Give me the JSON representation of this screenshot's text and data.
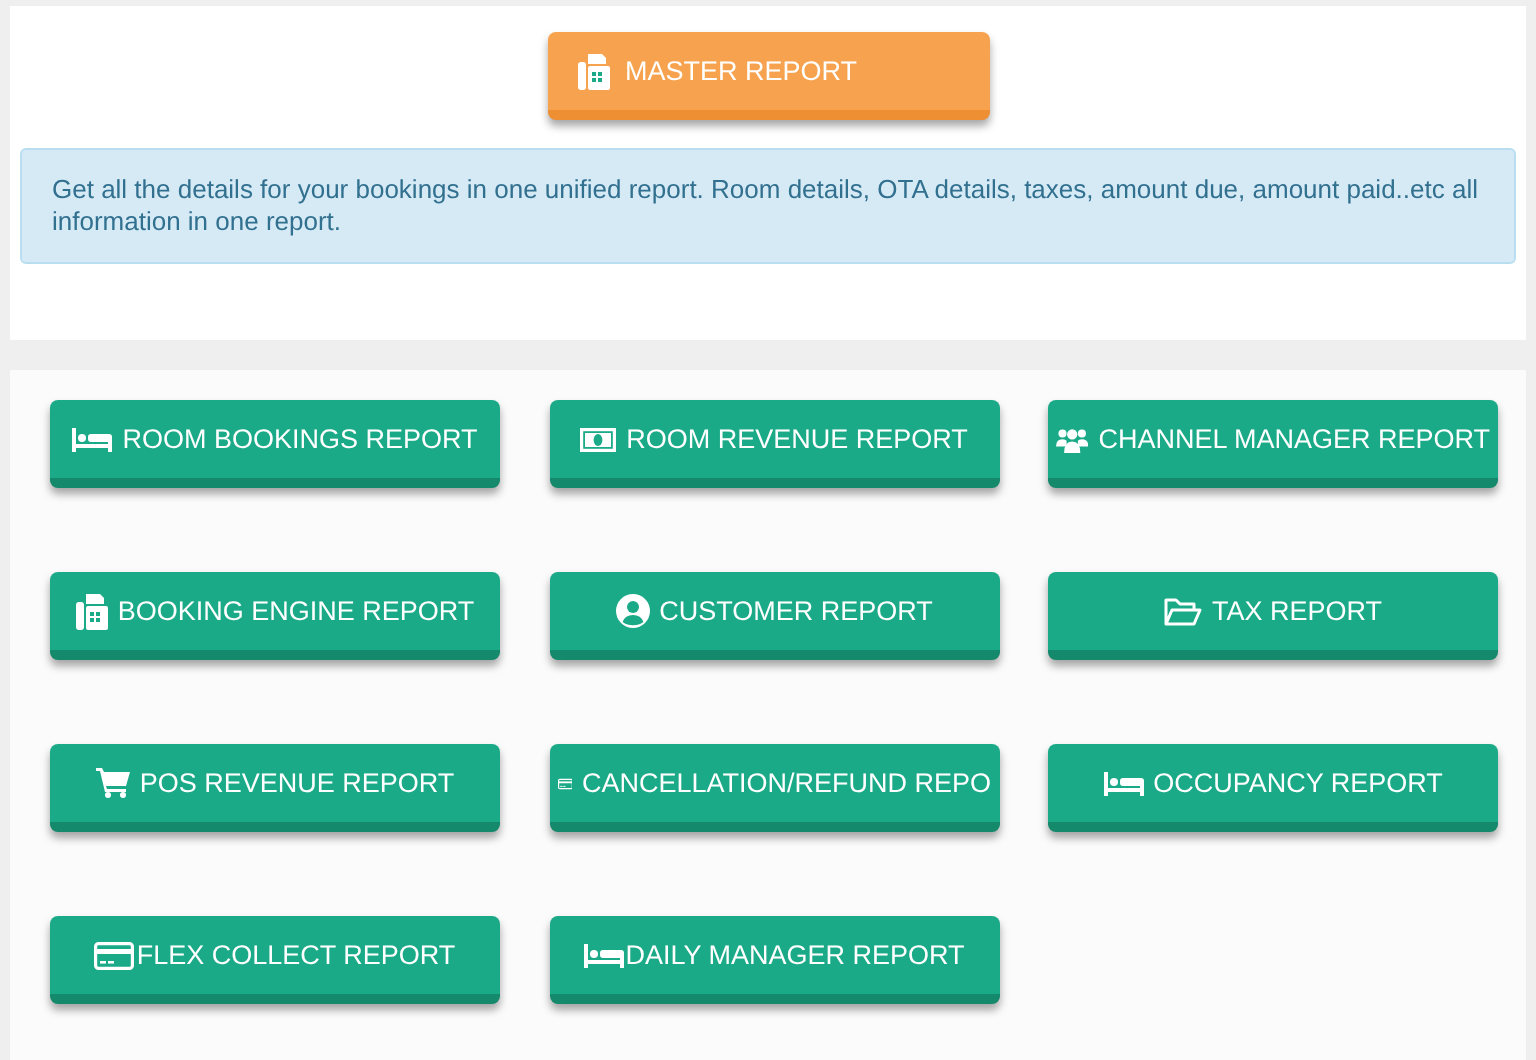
{
  "master_report": {
    "label": "MASTER REPORT"
  },
  "info": "Get all the details for your bookings in one unified report. Room details, OTA details, taxes, amount due, amount paid..etc all information in one report.",
  "reports": [
    {
      "label": "ROOM BOOKINGS REPORT"
    },
    {
      "label": "ROOM REVENUE REPORT"
    },
    {
      "label": "CHANNEL MANAGER REPORT"
    },
    {
      "label": "BOOKING ENGINE REPORT"
    },
    {
      "label": "CUSTOMER REPORT"
    },
    {
      "label": "TAX REPORT"
    },
    {
      "label": "POS REVENUE REPORT"
    },
    {
      "label": "CANCELLATION/REFUND REPO"
    },
    {
      "label": "OCCUPANCY REPORT"
    },
    {
      "label": "FLEX COLLECT REPORT"
    },
    {
      "label": "DAILY MANAGER REPORT"
    }
  ]
}
